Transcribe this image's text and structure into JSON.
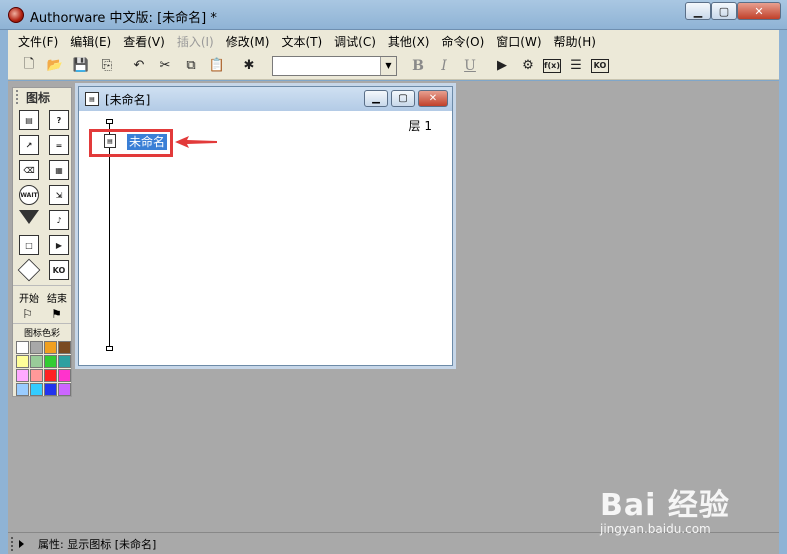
{
  "window": {
    "title": "Authorware 中文版: [未命名] *"
  },
  "menu": [
    "文件(F)",
    "编辑(E)",
    "查看(V)",
    "插入(I)",
    "修改(M)",
    "文本(T)",
    "调试(C)",
    "其他(X)",
    "命令(O)",
    "窗口(W)",
    "帮助(H)"
  ],
  "menu_disabled": [
    3
  ],
  "toolbar": {
    "font_combo_value": "",
    "bold": "B",
    "italic": "I",
    "underline": "U",
    "icon_fn": "f(x)",
    "icon_ko": "KO"
  },
  "palette": {
    "title": "图标",
    "icons": [
      "display",
      "interaction",
      "motion",
      "calculation",
      "erase",
      "digital-movie",
      "wait",
      "navigate",
      "decision",
      "sound",
      "framework",
      "video",
      "map",
      "knowledge-object"
    ],
    "wait_label": "WAIT",
    "ko_label": "KO",
    "start_label": "开始",
    "end_label": "结束",
    "color_label": "图标色彩",
    "colors": [
      "#ffffff",
      "#a8a8a8",
      "#f0a020",
      "#7a4a20",
      "#ffff99",
      "#99cc99",
      "#33cc33",
      "#2ca0a0",
      "#ffaaff",
      "#ff9999",
      "#ff2222",
      "#ff33cc",
      "#99ccff",
      "#33ccff",
      "#2233ee",
      "#cc66ff"
    ]
  },
  "flow_window": {
    "title": "[未命名]",
    "layer_label": "层 1",
    "icon_name": "未命名"
  },
  "status": {
    "text": "属性: 显示图标 [未命名]"
  },
  "watermark": {
    "brand": "Bai 经验",
    "url": "jingyan.baidu.com"
  }
}
